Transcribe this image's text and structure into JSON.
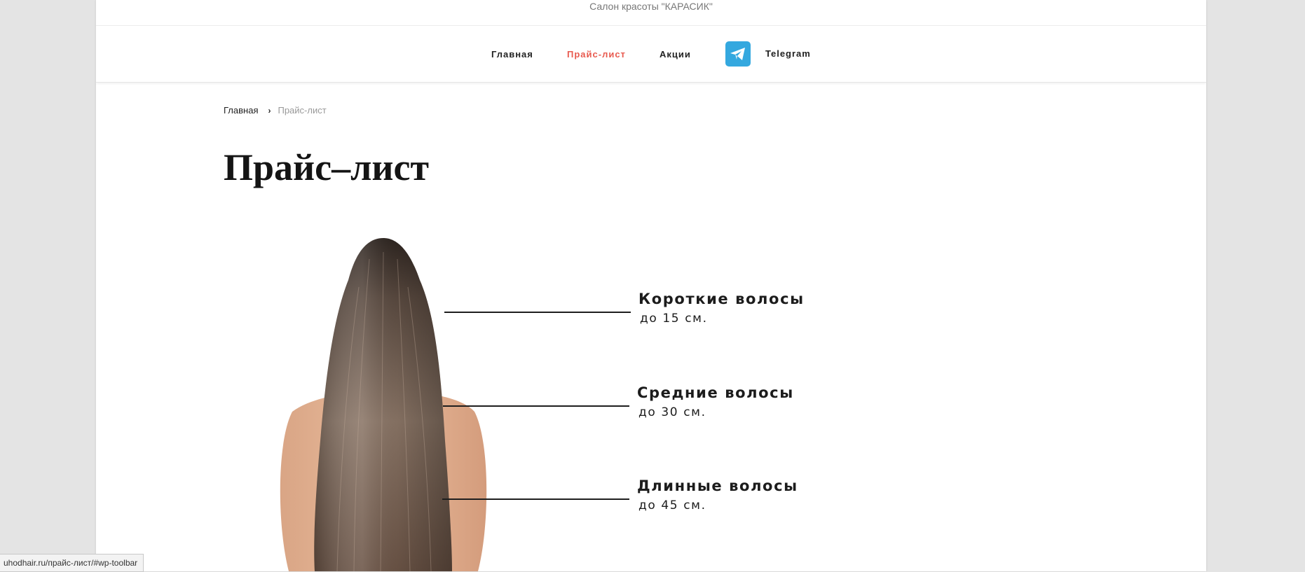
{
  "header": {
    "tagline": "Салон красоты \"КАРАСИК\""
  },
  "nav": {
    "items": [
      {
        "label": "Главная",
        "active": false
      },
      {
        "label": "Прайс-лист",
        "active": true
      },
      {
        "label": "Акции",
        "active": false
      }
    ],
    "telegram": {
      "label": "Telegram",
      "icon": "telegram-icon"
    }
  },
  "breadcrumb": {
    "home": "Главная",
    "separator_icon": "chevron-right-icon",
    "current": "Прайс-лист"
  },
  "page": {
    "title": "Прайс–лист"
  },
  "hair_lengths": [
    {
      "name": "Короткие волосы",
      "length": "до 15 см."
    },
    {
      "name": "Средние волосы",
      "length": "до 30 см."
    },
    {
      "name": "Длинные волосы",
      "length": "до 45 см."
    }
  ],
  "status_bar": {
    "url": "uhodhair.ru/прайс-лист/#wp-toolbar"
  },
  "colors": {
    "accent": "#e85a4f",
    "telegram": "#34a8df",
    "text": "#222222"
  }
}
